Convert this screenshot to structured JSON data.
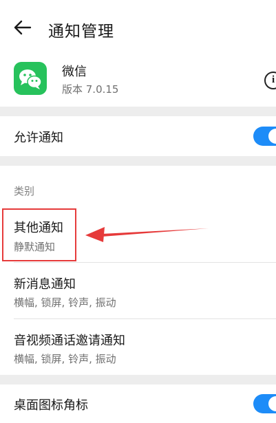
{
  "header": {
    "title": "通知管理",
    "back_icon": "back-arrow-icon"
  },
  "app": {
    "name": "微信",
    "version": "版本 7.0.15",
    "icon": "wechat-icon",
    "info_icon": "info-icon",
    "brand_color": "#27c25c"
  },
  "allow_notifications": {
    "label": "允许通知",
    "enabled": true
  },
  "category": {
    "header": "类别",
    "items": [
      {
        "title": "其他通知",
        "subtitle": "静默通知"
      },
      {
        "title": "新消息通知",
        "subtitle": "横幅, 锁屏, 铃声, 振动"
      },
      {
        "title": "音视频通话邀请通知",
        "subtitle": "横幅, 锁屏, 铃声, 振动"
      }
    ]
  },
  "badge": {
    "label": "桌面图标角标",
    "enabled": true
  },
  "colors": {
    "toggle_on": "#1d8cf8",
    "annotation_red": "#e63a3a"
  }
}
